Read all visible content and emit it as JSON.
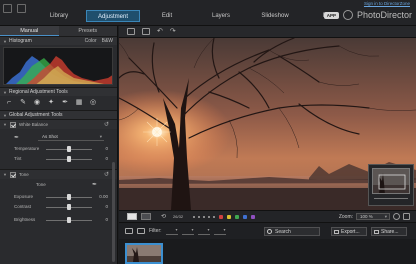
{
  "signin_link": "Sign in to DirectorZone",
  "nav": {
    "tabs": [
      "Library",
      "Adjustment",
      "Edit",
      "Layers",
      "Slideshow",
      "Print"
    ],
    "active": "Adjustment"
  },
  "brand": {
    "badge": "APP",
    "name": "PhotoDirector"
  },
  "left_panel": {
    "tabs": [
      "Manual",
      "Presets"
    ],
    "histogram": {
      "title": "Histogram",
      "mode_color": "Color",
      "mode_bw": "B&W"
    },
    "regional_title": "Regional Adjustment Tools",
    "global_title": "Global Adjustment Tools",
    "white_balance": {
      "title": "White Balance",
      "preset": "As Shot",
      "temperature_label": "Temperature",
      "temperature_value": "0",
      "tint_label": "Tint",
      "tint_value": "0"
    },
    "tone": {
      "title": "Tone",
      "subtitle": "Tone",
      "exposure_label": "Exposure",
      "exposure_value": "0.00",
      "contrast_label": "Contrast",
      "contrast_value": "0",
      "brightness_label": "Brightness",
      "brightness_value": "0"
    }
  },
  "viewer": {
    "zoom_label": "Zoom:",
    "zoom_value": "100 %",
    "info_readout": "26/32"
  },
  "filterbar": {
    "filter_label": "Filter:",
    "search_label": "Search",
    "export_label": "Export...",
    "share_label": "Share..."
  },
  "colors": {
    "accent": "#3a86b8",
    "flag_red": "#d04040",
    "flag_yellow": "#d8c030",
    "flag_green": "#40a850",
    "flag_blue": "#4070d0",
    "flag_purple": "#9050c0"
  },
  "icons": [
    "folder-icon",
    "cloud-icon",
    "undo-icon",
    "redo-icon",
    "crop-icon",
    "brush-icon",
    "eye-icon",
    "gradient-icon",
    "radial-icon",
    "search-icon"
  ]
}
